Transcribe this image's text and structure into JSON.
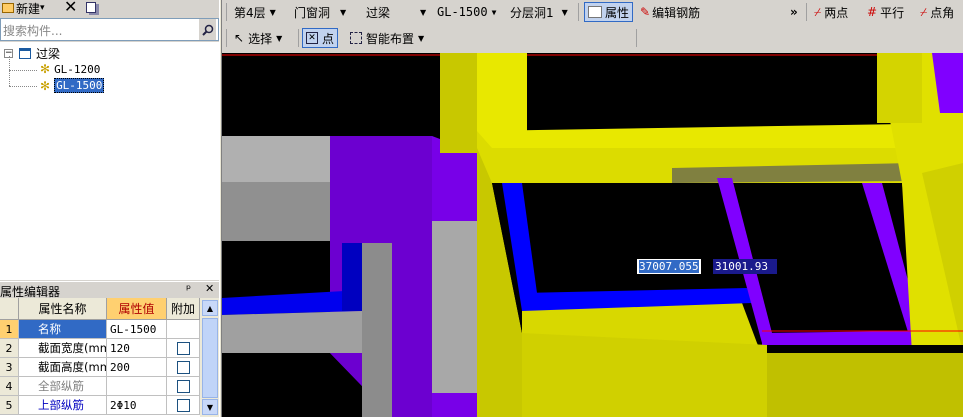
{
  "left_panel": {
    "toolbar": {
      "new_label": "新建",
      "new_arrow": "▾"
    },
    "search": {
      "placeholder": "搜索构件..."
    },
    "tree": {
      "root": "过梁",
      "items": [
        "GL-1200",
        "GL-1500"
      ],
      "selected": "GL-1500"
    }
  },
  "property_editor": {
    "title": "属性编辑器",
    "pin": "ꟸ",
    "close": "✕",
    "headers": {
      "name": "属性名称",
      "value": "属性值",
      "extra": "附加"
    },
    "rows": [
      {
        "num": "1",
        "name": "名称",
        "value": "GL-1500",
        "has_check": false,
        "name_color": "#000"
      },
      {
        "num": "2",
        "name": "截面宽度(mm",
        "value": "120",
        "has_check": true,
        "name_color": "#000"
      },
      {
        "num": "3",
        "name": "截面高度(mm",
        "value": "200",
        "has_check": true,
        "name_color": "#000"
      },
      {
        "num": "4",
        "name": "全部纵筋",
        "value": "",
        "has_check": true,
        "name_color": "#808080"
      },
      {
        "num": "5",
        "name": "上部纵筋",
        "value": "2Φ10",
        "has_check": true,
        "name_color": "#0000c0"
      }
    ]
  },
  "toolbar": {
    "floor": "第4层",
    "category": "门窗洞",
    "type": "过梁",
    "component": "GL-1500",
    "layer": "分层洞1",
    "properties_button": "属性",
    "edit_rebar_button": "编辑钢筋",
    "overflow": "»",
    "two_point": "两点",
    "parallel": "平行",
    "point_angle": "点角",
    "select": "选择",
    "point": "点",
    "smart_place": "智能布置"
  },
  "viewport": {
    "coord_x": "37007.055",
    "coord_y": "31001.93"
  },
  "colors": {
    "yellow": "#e8e800",
    "yellow_dark": "#c8c800",
    "purple": "#8000ff",
    "gray": "#b0b0b0",
    "blue": "#0000ff",
    "olive": "#808040"
  }
}
